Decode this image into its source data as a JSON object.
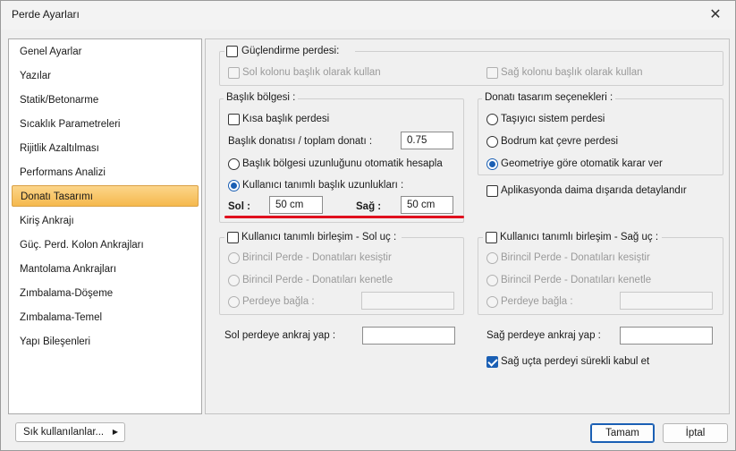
{
  "window": {
    "title": "Perde Ayarları"
  },
  "sidebar": {
    "items": [
      {
        "label": "Genel Ayarlar"
      },
      {
        "label": "Yazılar"
      },
      {
        "label": "Statik/Betonarme"
      },
      {
        "label": "Sıcaklık Parametreleri"
      },
      {
        "label": "Rijitlik Azaltılması"
      },
      {
        "label": "Performans Analizi"
      },
      {
        "label": "Donatı Tasarımı"
      },
      {
        "label": "Kiriş Ankrajı"
      },
      {
        "label": "Güç. Perd. Kolon Ankrajları"
      },
      {
        "label": "Mantolama Ankrajları"
      },
      {
        "label": "Zımbalama-Döşeme"
      },
      {
        "label": "Zımbalama-Temel"
      },
      {
        "label": "Yapı Bileşenleri"
      }
    ],
    "active_index": 6
  },
  "reinforcement": {
    "title": "Güçlendirme perdesi:",
    "left_col": "Sol kolonu başlık olarak kullan",
    "right_col": "Sağ kolonu başlık olarak kullan"
  },
  "head_zone": {
    "title": "Başlık bölgesi :",
    "short_head": "Kısa başlık perdesi",
    "ratio_label": "Başlık donatısı / toplam donatı :",
    "ratio_value": "0.75",
    "auto_calc": "Başlık bölgesi uzunluğunu otomatik hesapla",
    "user_defined": "Kullanıcı tanımlı başlık uzunlukları :",
    "left_label": "Sol :",
    "left_value": "50 cm",
    "right_label": "Sağ :",
    "right_value": "50 cm"
  },
  "design_options": {
    "title": "Donatı tasarım seçenekleri :",
    "opt1": "Taşıyıcı sistem perdesi",
    "opt2": "Bodrum kat çevre perdesi",
    "opt3": "Geometriye göre otomatik karar ver",
    "detail_outside": "Aplikasyonda daima dışarıda detaylandır"
  },
  "left_joint": {
    "title": "Kullanıcı tanımlı birleşim - Sol uç :",
    "opt1": "Birincil Perde - Donatıları kesiştir",
    "opt2": "Birincil Perde - Donatıları kenetle",
    "opt3": "Perdeye bağla :"
  },
  "right_joint": {
    "title": "Kullanıcı tanımlı birleşim - Sağ uç :",
    "opt1": "Birincil Perde - Donatıları kesiştir",
    "opt2": "Birincil Perde - Donatıları kenetle",
    "opt3": "Perdeye bağla :"
  },
  "anchorage": {
    "left_label": "Sol perdeye ankraj yap :",
    "right_label": "Sağ perdeye ankraj yap :",
    "continuous": "Sağ uçta perdeyi sürekli kabul et"
  },
  "footer": {
    "frequent": "Sık kullanılanlar...",
    "ok": "Tamam",
    "cancel": "İptal"
  }
}
